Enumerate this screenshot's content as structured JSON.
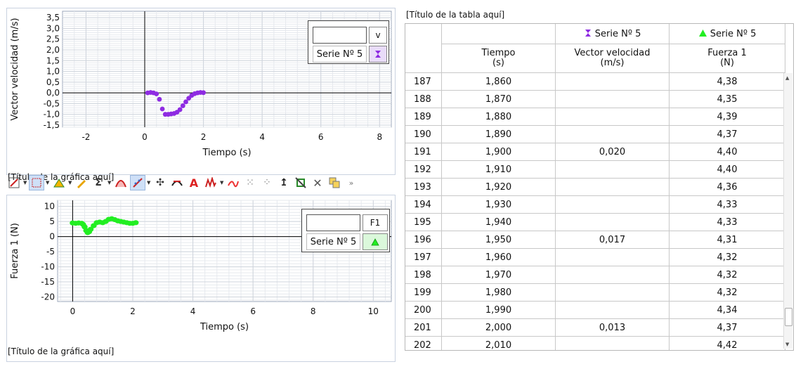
{
  "graph_top": {
    "legend": {
      "variable": "v",
      "series": "Serie Nº 5",
      "color": "#8e2be2"
    },
    "caption": "[Título de la gráfica aquí]"
  },
  "graph_bottom": {
    "legend": {
      "variable": "F1",
      "series": "Serie Nº 5",
      "color": "#22ee22"
    },
    "caption": "[Título de la gráfica aquí]"
  },
  "toolbar": {
    "icons": [
      "autoscale-icon",
      "zoom-region-icon",
      "triangle-fill-icon",
      "pencil-icon",
      "sigma-icon",
      "curve-fit-icon",
      "linear-fit-icon",
      "crosshair-icon",
      "tangent-icon",
      "annotation-icon",
      "fft-icon",
      "interpolate-icon",
      "point-remove-icon",
      "point-restore-icon",
      "arrow-up-icon",
      "strike-icon",
      "delete-icon",
      "copy-icon",
      "more-icon"
    ]
  },
  "table": {
    "title": "[Título de la tabla aquí]",
    "series_headers": [
      {
        "name": "Serie Nº 5",
        "symbol": "hourglass",
        "color": "#8e2be2"
      },
      {
        "name": "Serie Nº 5",
        "symbol": "triangle",
        "color": "#22ee22"
      }
    ],
    "columns": [
      {
        "name": "Tiempo",
        "unit": "(s)"
      },
      {
        "name": "Vector velocidad",
        "unit": "(m/s)"
      },
      {
        "name": "Fuerza 1",
        "unit": "(N)"
      }
    ],
    "rows": [
      [
        "187",
        "1,860",
        "",
        "4,38"
      ],
      [
        "188",
        "1,870",
        "",
        "4,35"
      ],
      [
        "189",
        "1,880",
        "",
        "4,39"
      ],
      [
        "190",
        "1,890",
        "",
        "4,37"
      ],
      [
        "191",
        "1,900",
        "0,020",
        "4,40"
      ],
      [
        "192",
        "1,910",
        "",
        "4,40"
      ],
      [
        "193",
        "1,920",
        "",
        "4,36"
      ],
      [
        "194",
        "1,930",
        "",
        "4,33"
      ],
      [
        "195",
        "1,940",
        "",
        "4,33"
      ],
      [
        "196",
        "1,950",
        "0,017",
        "4,31"
      ],
      [
        "197",
        "1,960",
        "",
        "4,32"
      ],
      [
        "198",
        "1,970",
        "",
        "4,32"
      ],
      [
        "199",
        "1,980",
        "",
        "4,32"
      ],
      [
        "200",
        "1,990",
        "",
        "4,34"
      ],
      [
        "201",
        "2,000",
        "0,013",
        "4,37"
      ],
      [
        "202",
        "2,010",
        "",
        "4,42"
      ]
    ]
  },
  "chart_data": [
    {
      "type": "scatter",
      "title": "",
      "xlabel": "Tiempo (s)",
      "ylabel": "Vector velocidad (m/s)",
      "xlim": [
        -2.8,
        8.4
      ],
      "ylim": [
        -1.6,
        3.8
      ],
      "xticks": [
        -2,
        0,
        2,
        4,
        6,
        8
      ],
      "xtick_labels": [
        "-2",
        "0",
        "2",
        "4",
        "6",
        "8"
      ],
      "yticks": [
        -1.5,
        -1.0,
        -0.5,
        0.0,
        0.5,
        1.0,
        1.5,
        2.0,
        2.5,
        3.0,
        3.5
      ],
      "ytick_labels": [
        "-1,5",
        "-1,0",
        "-0,5",
        "0,0",
        "0,5",
        "1,0",
        "1,5",
        "2,0",
        "2,5",
        "3,0",
        "3,5"
      ],
      "grid": true,
      "series": [
        {
          "name": "Serie Nº 5",
          "color": "#8e2be2",
          "x": [
            0.1,
            0.2,
            0.3,
            0.4,
            0.5,
            0.6,
            0.7,
            0.8,
            0.9,
            1.0,
            1.1,
            1.2,
            1.3,
            1.4,
            1.5,
            1.6,
            1.7,
            1.8,
            1.9,
            2.0
          ],
          "y": [
            0.0,
            0.02,
            0.0,
            -0.05,
            -0.3,
            -0.75,
            -1.0,
            -1.0,
            -0.98,
            -0.96,
            -0.9,
            -0.78,
            -0.6,
            -0.42,
            -0.25,
            -0.12,
            -0.04,
            0.0,
            0.02,
            0.01
          ]
        }
      ]
    },
    {
      "type": "scatter",
      "title": "",
      "xlabel": "Tiempo (s)",
      "ylabel": "Fuerza 1 (N)",
      "xlim": [
        -0.5,
        10.6
      ],
      "ylim": [
        -21.5,
        12
      ],
      "xticks": [
        0,
        2,
        4,
        6,
        8,
        10
      ],
      "xtick_labels": [
        "0",
        "2",
        "4",
        "6",
        "8",
        "10"
      ],
      "yticks": [
        -20,
        -15,
        -10,
        -5,
        0,
        5,
        10
      ],
      "ytick_labels": [
        "-20",
        "-15",
        "-10",
        "-5",
        "0",
        "5",
        "10"
      ],
      "grid": true,
      "series": [
        {
          "name": "Serie Nº 5",
          "color": "#22ee22",
          "x": [
            0.0,
            0.1,
            0.2,
            0.3,
            0.35,
            0.4,
            0.45,
            0.5,
            0.55,
            0.6,
            0.7,
            0.8,
            0.9,
            1.0,
            1.1,
            1.2,
            1.3,
            1.4,
            1.5,
            1.6,
            1.7,
            1.8,
            1.9,
            2.0,
            2.1
          ],
          "y": [
            4.5,
            4.4,
            4.5,
            4.4,
            4.0,
            3.2,
            2.0,
            1.3,
            1.6,
            2.4,
            3.6,
            4.6,
            4.8,
            4.6,
            5.0,
            5.7,
            5.9,
            5.6,
            5.2,
            5.0,
            4.8,
            4.6,
            4.4,
            4.4,
            4.6
          ]
        }
      ]
    }
  ]
}
